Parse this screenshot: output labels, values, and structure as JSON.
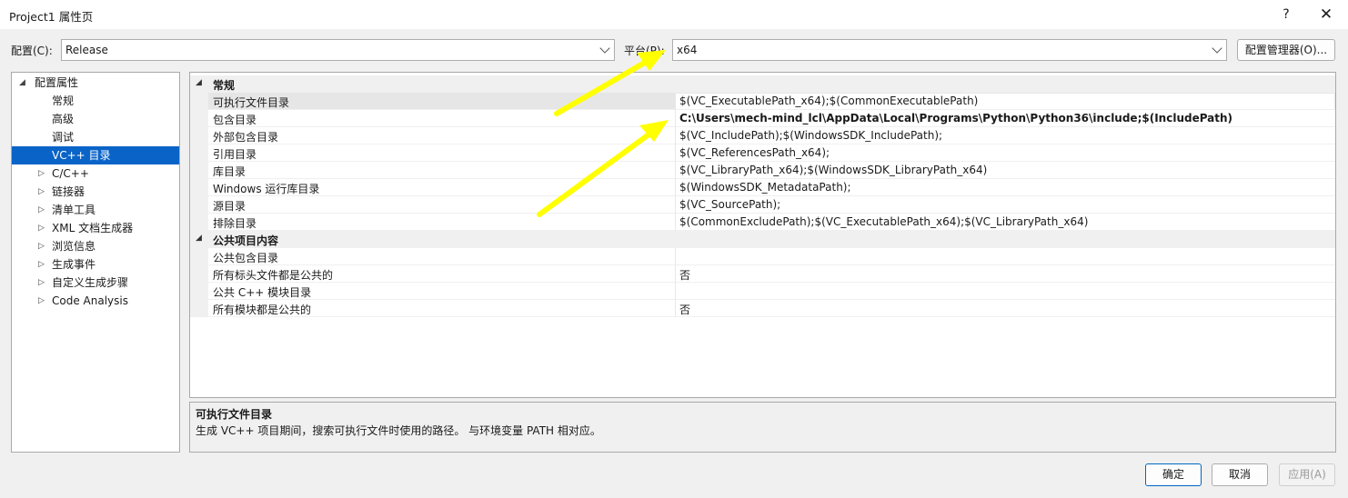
{
  "window": {
    "title": "Project1 属性页",
    "help": "?",
    "close": "✕"
  },
  "toolbar": {
    "config_label": "配置(C):",
    "config_value": "Release",
    "platform_label": "平台(P):",
    "platform_value": "x64",
    "manager_button": "配置管理器(O)..."
  },
  "tree": {
    "items": [
      {
        "label": "配置属性",
        "expander": "◢"
      },
      {
        "label": "常规"
      },
      {
        "label": "高级"
      },
      {
        "label": "调试"
      },
      {
        "label": "VC++ 目录"
      },
      {
        "label": "C/C++",
        "expander": "▷"
      },
      {
        "label": "链接器",
        "expander": "▷"
      },
      {
        "label": "清单工具",
        "expander": "▷"
      },
      {
        "label": "XML 文档生成器",
        "expander": "▷"
      },
      {
        "label": "浏览信息",
        "expander": "▷"
      },
      {
        "label": "生成事件",
        "expander": "▷"
      },
      {
        "label": "自定义生成步骤",
        "expander": "▷"
      },
      {
        "label": "Code Analysis",
        "expander": "▷"
      }
    ]
  },
  "grid": {
    "categories": [
      {
        "name": "常规",
        "caret": "◢",
        "rows": [
          {
            "name": "可执行文件目录",
            "value": "$(VC_ExecutablePath_x64);$(CommonExecutablePath)"
          },
          {
            "name": "包含目录",
            "value": "C:\\Users\\mech-mind_lcl\\AppData\\Local\\Programs\\Python\\Python36\\include;$(IncludePath)"
          },
          {
            "name": "外部包含目录",
            "value": "$(VC_IncludePath);$(WindowsSDK_IncludePath);"
          },
          {
            "name": "引用目录",
            "value": "$(VC_ReferencesPath_x64);"
          },
          {
            "name": "库目录",
            "value": "$(VC_LibraryPath_x64);$(WindowsSDK_LibraryPath_x64)"
          },
          {
            "name": "Windows 运行库目录",
            "value": "$(WindowsSDK_MetadataPath);"
          },
          {
            "name": "源目录",
            "value": "$(VC_SourcePath);"
          },
          {
            "name": "排除目录",
            "value": "$(CommonExcludePath);$(VC_ExecutablePath_x64);$(VC_LibraryPath_x64)"
          }
        ]
      },
      {
        "name": "公共项目内容",
        "caret": "◢",
        "rows": [
          {
            "name": "公共包含目录",
            "value": ""
          },
          {
            "name": "所有标头文件都是公共的",
            "value": "否"
          },
          {
            "name": "公共 C++ 模块目录",
            "value": ""
          },
          {
            "name": "所有模块都是公共的",
            "value": "否"
          }
        ]
      }
    ]
  },
  "description": {
    "title": "可执行文件目录",
    "text": "生成 VC++ 项目期间，搜索可执行文件时使用的路径。 与环境变量 PATH 相对应。"
  },
  "buttons": {
    "ok": "确定",
    "cancel": "取消",
    "apply": "应用(A)"
  },
  "colors": {
    "selection": "#0a64c8",
    "annotation_arrow": "#ffff00"
  }
}
